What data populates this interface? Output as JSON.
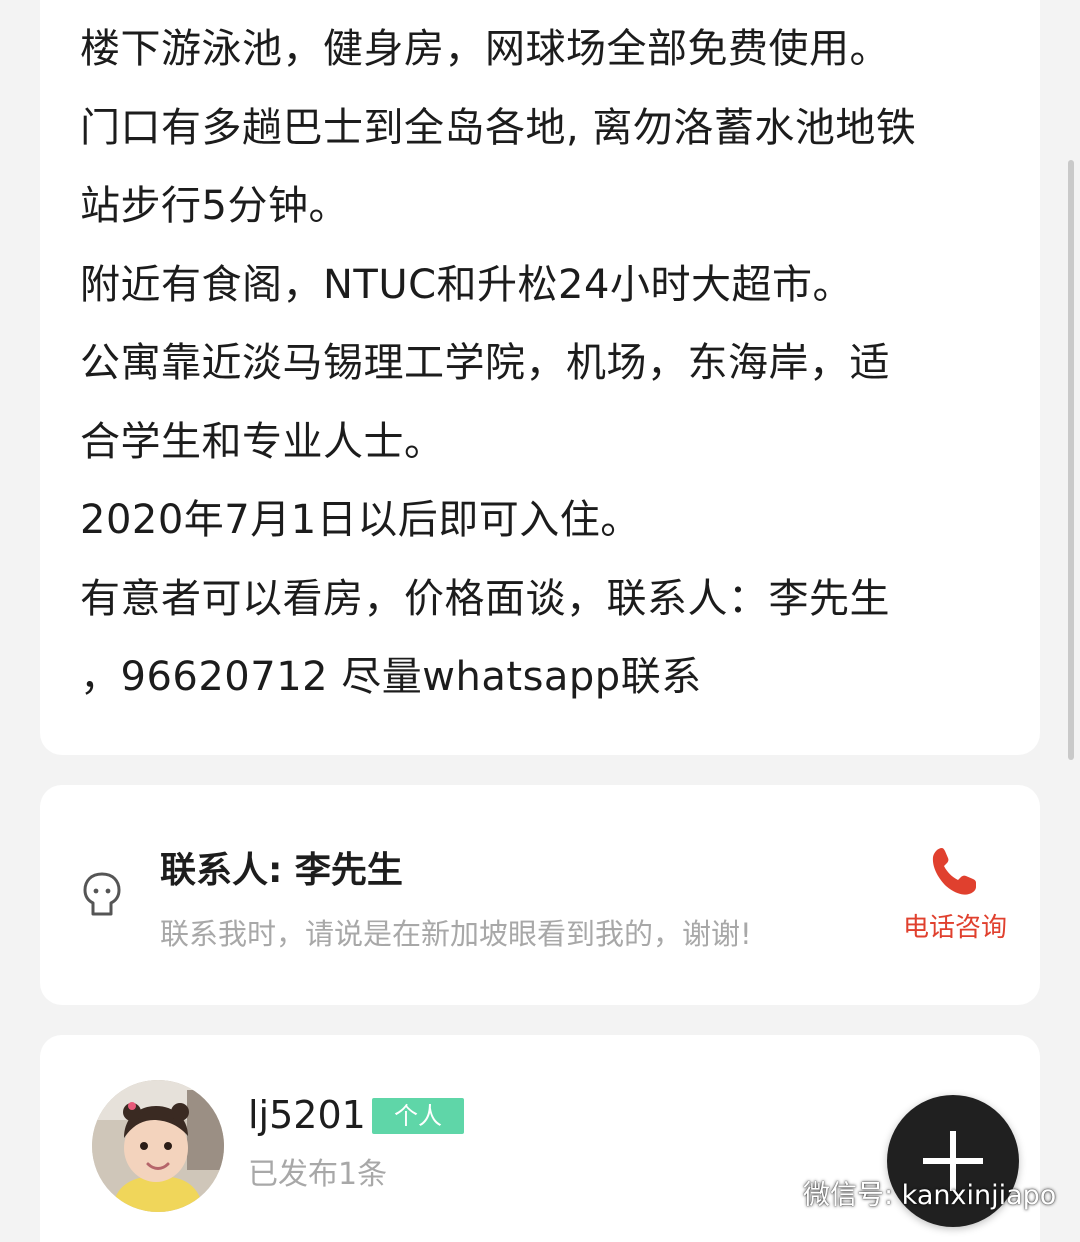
{
  "listing": {
    "description_lines": [
      "楼下游泳池，健身房，网球场全部免费使用。",
      "门口有多趟巴士到全岛各地, 离勿洛蓄水池地铁",
      "站步行5分钟。",
      "附近有食阁，NTUC和升松24小时大超市。",
      "公寓靠近淡马锡理工学院，机场，东海岸，适",
      "合学生和专业人士。",
      "2020年7月1日以后即可入住。",
      "有意者可以看房，价格面谈，联系人：李先生",
      "，96620712 尽量whatsapp联系"
    ]
  },
  "contact": {
    "title": "联系人: 李先生",
    "note": "联系我时，请说是在新加坡眼看到我的，谢谢!",
    "call_label": "电话咨询",
    "call_color": "#e0402e",
    "icon": "person-outline-icon"
  },
  "publisher": {
    "username": "lj5201",
    "badge": "个人",
    "badge_color": "#5fd6a8",
    "post_count_text": "已发布1条"
  },
  "fab": {
    "icon": "plus-icon"
  },
  "watermark": {
    "text": "微信号: kanxinjiapo",
    "icon": "wechat-icon"
  }
}
